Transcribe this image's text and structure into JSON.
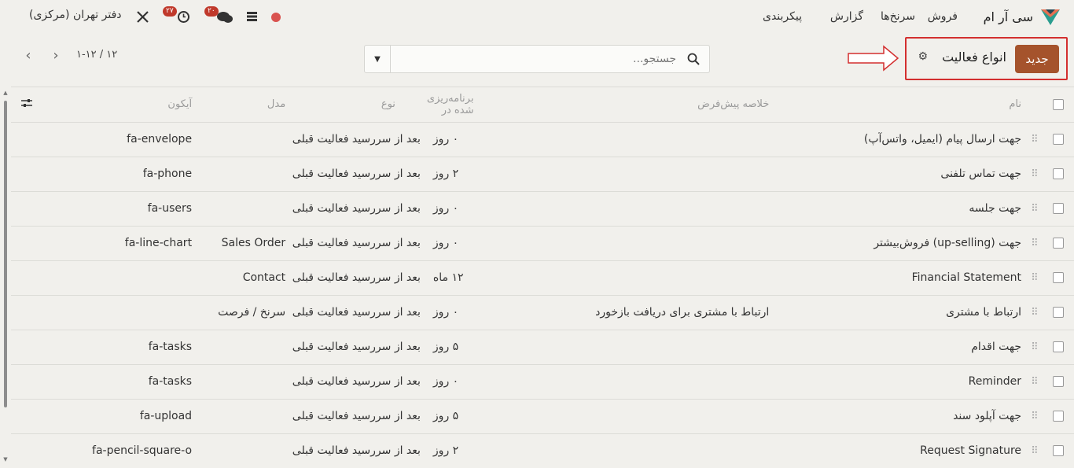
{
  "navbar": {
    "app_name": "سی آر ام",
    "menu": [
      "فروش",
      "سرنخ‌ها",
      "گزارش",
      "پیکربندی"
    ],
    "company": "دفتر تهران (مرکزی)",
    "activity_badge": "۲۷",
    "messages_badge": "۲۰"
  },
  "control": {
    "new_label": "جدید",
    "title": "انواع فعالیت",
    "search_placeholder": "جستجو...",
    "pager": "۱-۱۲ / ۱۲"
  },
  "table": {
    "headers": {
      "name": "نام",
      "summary": "خلاصه پیش‌فرض",
      "scheduled": "برنامه‌ریزی شده در",
      "type": "نوع",
      "model": "مدل",
      "icon": "آیکون"
    },
    "rows": [
      {
        "name": "جهت ارسال پیام (ایمیل، واتس‌آپ)",
        "summary": "",
        "delay": "۰ روز",
        "type": "بعد از سررسید فعالیت قبلی",
        "model": "",
        "icon": "fa-envelope"
      },
      {
        "name": "جهت تماس تلفنی",
        "summary": "",
        "delay": "۲ روز",
        "type": "بعد از سررسید فعالیت قبلی",
        "model": "",
        "icon": "fa-phone"
      },
      {
        "name": "جهت جلسه",
        "summary": "",
        "delay": "۰ روز",
        "type": "بعد از سررسید فعالیت قبلی",
        "model": "",
        "icon": "fa-users"
      },
      {
        "name": "جهت (up-selling) فروش‌بیشتر",
        "summary": "",
        "delay": "۰ روز",
        "type": "بعد از سررسید فعالیت قبلی",
        "model": "Sales Order",
        "icon": "fa-line-chart"
      },
      {
        "name": "Financial Statement",
        "summary": "",
        "delay": "۱۲ ماه",
        "type": "بعد از سررسید فعالیت قبلی",
        "model": "Contact",
        "icon": ""
      },
      {
        "name": "ارتباط با مشتری",
        "summary": "ارتباط با مشتری برای دریافت بازخورد",
        "delay": "۰ روز",
        "type": "بعد از سررسید فعالیت قبلی",
        "model": "سرنخ / فرصت",
        "icon": ""
      },
      {
        "name": "جهت اقدام",
        "summary": "",
        "delay": "۵ روز",
        "type": "بعد از سررسید فعالیت قبلی",
        "model": "",
        "icon": "fa-tasks"
      },
      {
        "name": "Reminder",
        "summary": "",
        "delay": "۰ روز",
        "type": "بعد از سررسید فعالیت قبلی",
        "model": "",
        "icon": "fa-tasks"
      },
      {
        "name": "جهت آپلود سند",
        "summary": "",
        "delay": "۵ روز",
        "type": "بعد از سررسید فعالیت قبلی",
        "model": "",
        "icon": "fa-upload"
      },
      {
        "name": "Request Signature",
        "summary": "",
        "delay": "۲ روز",
        "type": "بعد از سررسید فعالیت قبلی",
        "model": "",
        "icon": "fa-pencil-square-o"
      }
    ]
  }
}
